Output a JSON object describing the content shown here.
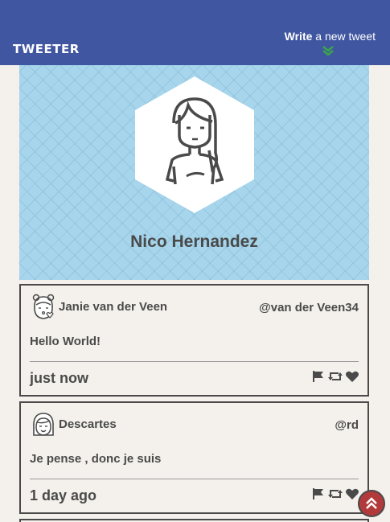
{
  "nav": {
    "brand": "TWEETER",
    "compose_bold": "Write",
    "compose_rest": " a new tweet",
    "chevron_icon": "chevron-double-down-icon",
    "accent": "#4056a1",
    "chevron_color": "#3aa64a"
  },
  "profile": {
    "name": "Nico Hernandez",
    "avatar_icon": "user-avatar-icon",
    "background": "#a6d5ec"
  },
  "tweets": [
    {
      "name": "Janie van der Veen",
      "handle": "@van der Veen34",
      "body": "Hello World!",
      "time": "just now",
      "avatar_icon": "avatar-kiss-icon"
    },
    {
      "name": "Descartes",
      "handle": "@rd",
      "body": "Je pense , donc je suis",
      "time": "1 day ago",
      "avatar_icon": "avatar-smile-icon"
    }
  ],
  "actions": {
    "flag_icon": "flag-icon",
    "retweet_icon": "retweet-icon",
    "like_icon": "heart-icon"
  },
  "scroll_top": {
    "icon": "chevron-double-up-icon",
    "color": "#b33a3a"
  }
}
